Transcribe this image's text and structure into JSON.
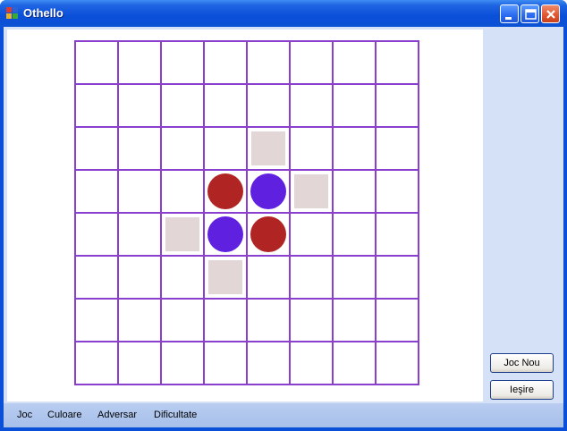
{
  "window": {
    "title": "Othello"
  },
  "board": {
    "rows": 8,
    "cols": 8,
    "colors": {
      "grid": "#8a3fcf",
      "red": "#b02424",
      "blue": "#6020e0",
      "hint": "#e2d6d6"
    },
    "pieces": [
      {
        "row": 3,
        "col": 3,
        "color": "red"
      },
      {
        "row": 3,
        "col": 4,
        "color": "blue"
      },
      {
        "row": 4,
        "col": 3,
        "color": "blue"
      },
      {
        "row": 4,
        "col": 4,
        "color": "red"
      }
    ],
    "valid_moves": [
      {
        "row": 2,
        "col": 4
      },
      {
        "row": 3,
        "col": 5
      },
      {
        "row": 4,
        "col": 2
      },
      {
        "row": 5,
        "col": 3
      }
    ]
  },
  "buttons": {
    "new_game": "Joc Nou",
    "exit": "Ieşire"
  },
  "menu": {
    "items": [
      "Joc",
      "Culoare",
      "Adversar",
      "Dificultate"
    ]
  }
}
